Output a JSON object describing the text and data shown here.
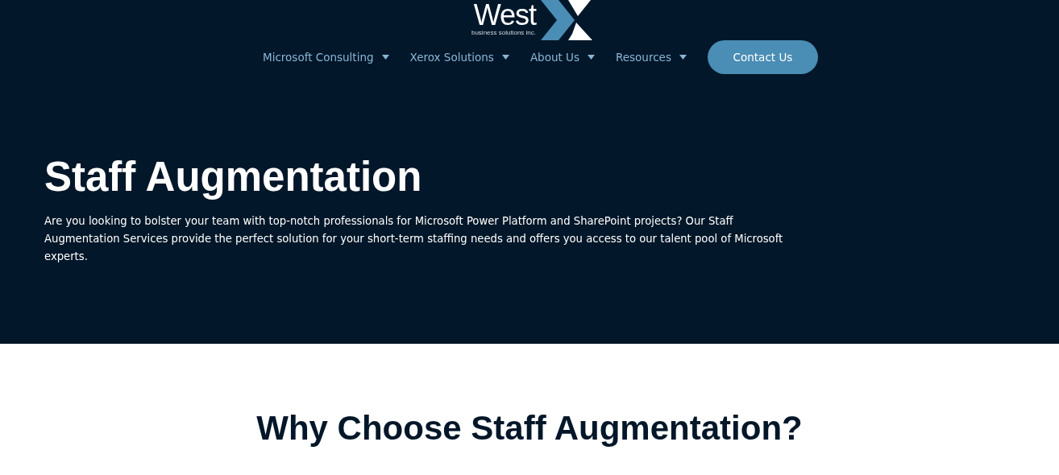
{
  "logo": {
    "name": "West",
    "tagline": "business solutions inc."
  },
  "nav": [
    {
      "label": "Microsoft Consulting",
      "dropdown": true
    },
    {
      "label": "Xerox Solutions",
      "dropdown": true
    },
    {
      "label": "About Us",
      "dropdown": true
    },
    {
      "label": "Resources",
      "dropdown": true
    }
  ],
  "contact_button": "Contact Us",
  "hero": {
    "title": "Staff Augmentation",
    "text": "Are you looking to bolster your team with top-notch professionals for Microsoft Power Platform and SharePoint projects? Our Staff Augmentation Services provide the perfect solution for your short-term staffing needs and offers you access to our talent pool of Microsoft experts."
  },
  "section": {
    "title": "Why Choose Staff Augmentation?"
  }
}
